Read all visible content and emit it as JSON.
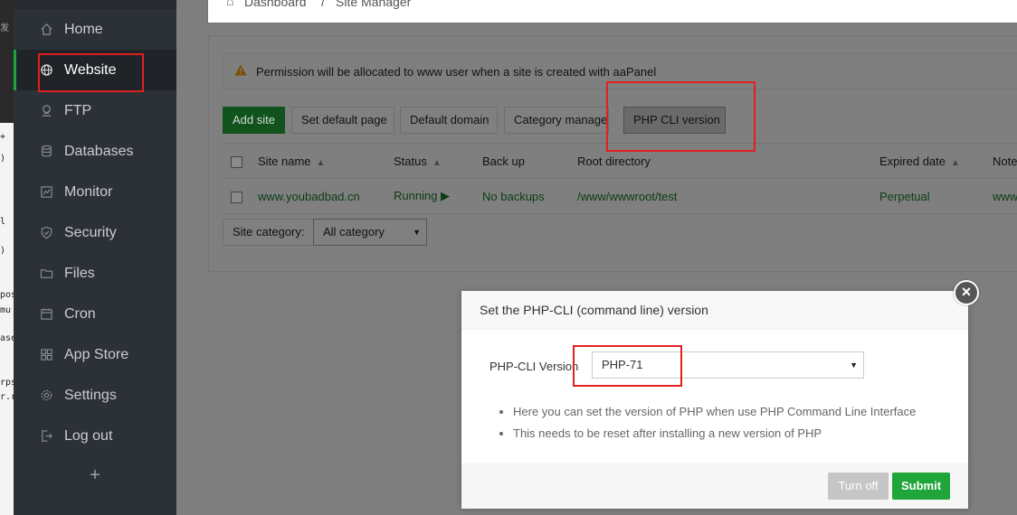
{
  "sidebar": {
    "items": [
      {
        "label": "Home",
        "icon": "home-icon"
      },
      {
        "label": "Website",
        "icon": "globe-icon",
        "active": true
      },
      {
        "label": "FTP",
        "icon": "ftp-icon"
      },
      {
        "label": "Databases",
        "icon": "database-icon"
      },
      {
        "label": "Monitor",
        "icon": "monitor-icon"
      },
      {
        "label": "Security",
        "icon": "shield-icon"
      },
      {
        "label": "Files",
        "icon": "folder-icon"
      },
      {
        "label": "Cron",
        "icon": "calendar-icon"
      },
      {
        "label": "App Store",
        "icon": "grid-icon"
      },
      {
        "label": "Settings",
        "icon": "gear-icon"
      },
      {
        "label": "Log out",
        "icon": "logout-icon"
      }
    ],
    "add": "+"
  },
  "edge": {
    "glyphs": [
      "发",
      "+",
      ")",
      "l",
      ")",
      "pos",
      "mu",
      "ase",
      "rps",
      "r.r"
    ]
  },
  "breadcrumb": {
    "home": "Dashboard",
    "sep": "/",
    "current": "Site Manager"
  },
  "notice": "Permission will be allocated to www user when a site is created with aaPanel",
  "toolbar": {
    "add_site": "Add site",
    "set_default_page": "Set default page",
    "default_domain": "Default domain",
    "category_manager": "Category manager",
    "php_cli_version": "PHP CLI version"
  },
  "table": {
    "headers": {
      "site_name": "Site name",
      "status": "Status",
      "backup": "Back up",
      "root": "Root directory",
      "expired": "Expired date",
      "note": "Note"
    },
    "rows": [
      {
        "site_name": "www.youbadbad.cn",
        "status": "Running ▶",
        "backup": "No backups",
        "root": "/www/wwwroot/test",
        "expired": "Perpetual",
        "note": "www"
      }
    ]
  },
  "category": {
    "label": "Site category:",
    "value": "All category"
  },
  "dialog": {
    "title": "Set the PHP-CLI (command line) version",
    "version_label": "PHP-CLI Version",
    "version_value": "PHP-71",
    "tips": [
      "Here you can set the version of PHP when use PHP Command Line Interface",
      "This needs to be reset after installing a new version of PHP"
    ],
    "turn_off": "Turn off",
    "submit": "Submit",
    "close": "×"
  },
  "colors": {
    "accent": "#20a53a",
    "highlight": "#e02020",
    "sidebar": "#2c3138"
  }
}
